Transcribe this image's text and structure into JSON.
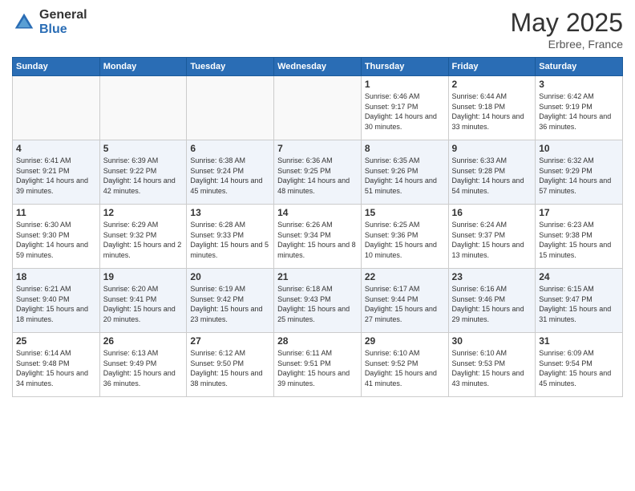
{
  "logo": {
    "general": "General",
    "blue": "Blue"
  },
  "header": {
    "title": "May 2025",
    "subtitle": "Erbree, France"
  },
  "weekdays": [
    "Sunday",
    "Monday",
    "Tuesday",
    "Wednesday",
    "Thursday",
    "Friday",
    "Saturday"
  ],
  "weeks": [
    [
      {
        "day": "",
        "sunrise": "",
        "sunset": "",
        "daylight": ""
      },
      {
        "day": "",
        "sunrise": "",
        "sunset": "",
        "daylight": ""
      },
      {
        "day": "",
        "sunrise": "",
        "sunset": "",
        "daylight": ""
      },
      {
        "day": "",
        "sunrise": "",
        "sunset": "",
        "daylight": ""
      },
      {
        "day": "1",
        "sunrise": "Sunrise: 6:46 AM",
        "sunset": "Sunset: 9:17 PM",
        "daylight": "Daylight: 14 hours and 30 minutes."
      },
      {
        "day": "2",
        "sunrise": "Sunrise: 6:44 AM",
        "sunset": "Sunset: 9:18 PM",
        "daylight": "Daylight: 14 hours and 33 minutes."
      },
      {
        "day": "3",
        "sunrise": "Sunrise: 6:42 AM",
        "sunset": "Sunset: 9:19 PM",
        "daylight": "Daylight: 14 hours and 36 minutes."
      }
    ],
    [
      {
        "day": "4",
        "sunrise": "Sunrise: 6:41 AM",
        "sunset": "Sunset: 9:21 PM",
        "daylight": "Daylight: 14 hours and 39 minutes."
      },
      {
        "day": "5",
        "sunrise": "Sunrise: 6:39 AM",
        "sunset": "Sunset: 9:22 PM",
        "daylight": "Daylight: 14 hours and 42 minutes."
      },
      {
        "day": "6",
        "sunrise": "Sunrise: 6:38 AM",
        "sunset": "Sunset: 9:24 PM",
        "daylight": "Daylight: 14 hours and 45 minutes."
      },
      {
        "day": "7",
        "sunrise": "Sunrise: 6:36 AM",
        "sunset": "Sunset: 9:25 PM",
        "daylight": "Daylight: 14 hours and 48 minutes."
      },
      {
        "day": "8",
        "sunrise": "Sunrise: 6:35 AM",
        "sunset": "Sunset: 9:26 PM",
        "daylight": "Daylight: 14 hours and 51 minutes."
      },
      {
        "day": "9",
        "sunrise": "Sunrise: 6:33 AM",
        "sunset": "Sunset: 9:28 PM",
        "daylight": "Daylight: 14 hours and 54 minutes."
      },
      {
        "day": "10",
        "sunrise": "Sunrise: 6:32 AM",
        "sunset": "Sunset: 9:29 PM",
        "daylight": "Daylight: 14 hours and 57 minutes."
      }
    ],
    [
      {
        "day": "11",
        "sunrise": "Sunrise: 6:30 AM",
        "sunset": "Sunset: 9:30 PM",
        "daylight": "Daylight: 14 hours and 59 minutes."
      },
      {
        "day": "12",
        "sunrise": "Sunrise: 6:29 AM",
        "sunset": "Sunset: 9:32 PM",
        "daylight": "Daylight: 15 hours and 2 minutes."
      },
      {
        "day": "13",
        "sunrise": "Sunrise: 6:28 AM",
        "sunset": "Sunset: 9:33 PM",
        "daylight": "Daylight: 15 hours and 5 minutes."
      },
      {
        "day": "14",
        "sunrise": "Sunrise: 6:26 AM",
        "sunset": "Sunset: 9:34 PM",
        "daylight": "Daylight: 15 hours and 8 minutes."
      },
      {
        "day": "15",
        "sunrise": "Sunrise: 6:25 AM",
        "sunset": "Sunset: 9:36 PM",
        "daylight": "Daylight: 15 hours and 10 minutes."
      },
      {
        "day": "16",
        "sunrise": "Sunrise: 6:24 AM",
        "sunset": "Sunset: 9:37 PM",
        "daylight": "Daylight: 15 hours and 13 minutes."
      },
      {
        "day": "17",
        "sunrise": "Sunrise: 6:23 AM",
        "sunset": "Sunset: 9:38 PM",
        "daylight": "Daylight: 15 hours and 15 minutes."
      }
    ],
    [
      {
        "day": "18",
        "sunrise": "Sunrise: 6:21 AM",
        "sunset": "Sunset: 9:40 PM",
        "daylight": "Daylight: 15 hours and 18 minutes."
      },
      {
        "day": "19",
        "sunrise": "Sunrise: 6:20 AM",
        "sunset": "Sunset: 9:41 PM",
        "daylight": "Daylight: 15 hours and 20 minutes."
      },
      {
        "day": "20",
        "sunrise": "Sunrise: 6:19 AM",
        "sunset": "Sunset: 9:42 PM",
        "daylight": "Daylight: 15 hours and 23 minutes."
      },
      {
        "day": "21",
        "sunrise": "Sunrise: 6:18 AM",
        "sunset": "Sunset: 9:43 PM",
        "daylight": "Daylight: 15 hours and 25 minutes."
      },
      {
        "day": "22",
        "sunrise": "Sunrise: 6:17 AM",
        "sunset": "Sunset: 9:44 PM",
        "daylight": "Daylight: 15 hours and 27 minutes."
      },
      {
        "day": "23",
        "sunrise": "Sunrise: 6:16 AM",
        "sunset": "Sunset: 9:46 PM",
        "daylight": "Daylight: 15 hours and 29 minutes."
      },
      {
        "day": "24",
        "sunrise": "Sunrise: 6:15 AM",
        "sunset": "Sunset: 9:47 PM",
        "daylight": "Daylight: 15 hours and 31 minutes."
      }
    ],
    [
      {
        "day": "25",
        "sunrise": "Sunrise: 6:14 AM",
        "sunset": "Sunset: 9:48 PM",
        "daylight": "Daylight: 15 hours and 34 minutes."
      },
      {
        "day": "26",
        "sunrise": "Sunrise: 6:13 AM",
        "sunset": "Sunset: 9:49 PM",
        "daylight": "Daylight: 15 hours and 36 minutes."
      },
      {
        "day": "27",
        "sunrise": "Sunrise: 6:12 AM",
        "sunset": "Sunset: 9:50 PM",
        "daylight": "Daylight: 15 hours and 38 minutes."
      },
      {
        "day": "28",
        "sunrise": "Sunrise: 6:11 AM",
        "sunset": "Sunset: 9:51 PM",
        "daylight": "Daylight: 15 hours and 39 minutes."
      },
      {
        "day": "29",
        "sunrise": "Sunrise: 6:10 AM",
        "sunset": "Sunset: 9:52 PM",
        "daylight": "Daylight: 15 hours and 41 minutes."
      },
      {
        "day": "30",
        "sunrise": "Sunrise: 6:10 AM",
        "sunset": "Sunset: 9:53 PM",
        "daylight": "Daylight: 15 hours and 43 minutes."
      },
      {
        "day": "31",
        "sunrise": "Sunrise: 6:09 AM",
        "sunset": "Sunset: 9:54 PM",
        "daylight": "Daylight: 15 hours and 45 minutes."
      }
    ]
  ]
}
